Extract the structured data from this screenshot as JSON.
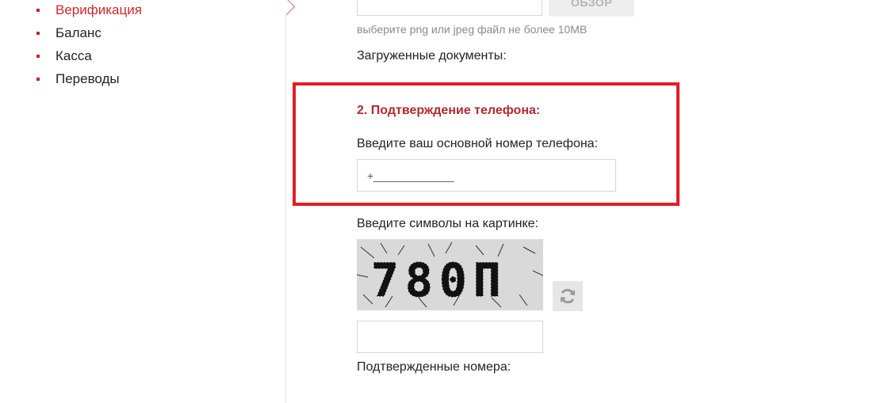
{
  "sidebar": {
    "items": [
      {
        "label": "Верификация",
        "active": true
      },
      {
        "label": "Баланс",
        "active": false
      },
      {
        "label": "Касса",
        "active": false
      },
      {
        "label": "Переводы",
        "active": false
      }
    ]
  },
  "upload": {
    "browse_label": "ОБЗОР",
    "file_value": "",
    "hint": "выберите png или jpeg файл не более 10MB",
    "uploaded_label": "Загруженные документы:"
  },
  "phone": {
    "heading": "2. Подтверждение телефона:",
    "prompt": "Введите ваш основной номер телефона:",
    "placeholder": "+_____________"
  },
  "captcha": {
    "label": "Введите символы на картинке:",
    "image_text": "780П",
    "refresh_icon": "refresh-icon",
    "input_value": ""
  },
  "confirmed": {
    "label": "Подтвержденные номера:"
  },
  "colors": {
    "accent": "#d1262c",
    "highlight_border": "#e31e24",
    "heading": "#b12a2f"
  }
}
